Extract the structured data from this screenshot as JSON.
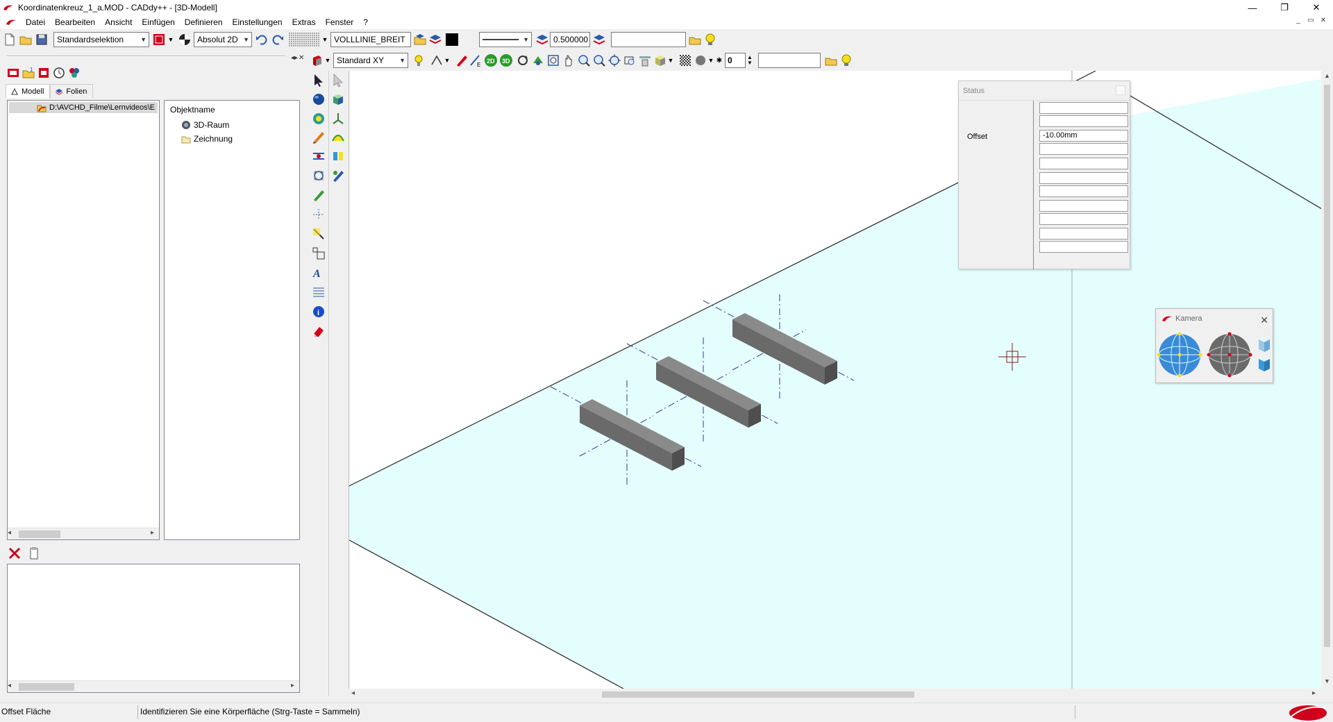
{
  "window": {
    "title": "Koordinatenkreuz_1_a.MOD  -  CADdy++ - [3D-Modell]",
    "controls": [
      "minimize-icon",
      "restore-icon",
      "close-icon"
    ]
  },
  "menu": [
    "Datei",
    "Bearbeiten",
    "Ansicht",
    "Einfügen",
    "Definieren",
    "Einstellungen",
    "Extras",
    "Fenster",
    "?"
  ],
  "toolbar1": {
    "selection_mode": "Standardselektion",
    "coord_mode": "Absolut 2D",
    "line_type": "VOLLLINIE_BREIT",
    "line_width": "0.500000",
    "text_field": ""
  },
  "toolbar2": {
    "view_plane": "Standard XY",
    "layer_value": "0",
    "text_field": ""
  },
  "left_panel": {
    "tabs": [
      "Modell",
      "Folien"
    ],
    "tree_path": "D:\\AVCHD_Filme\\Lernvideos\\E",
    "objects_header": "Objektname",
    "objects": [
      "3D-Raum",
      "Zeichnung"
    ]
  },
  "status_panel": {
    "title": "Status",
    "label": "Offset",
    "fields": [
      "",
      "",
      "-10.00mm",
      "",
      "",
      "",
      "",
      "",
      "",
      "",
      ""
    ]
  },
  "kamera_panel": {
    "title": "Kamera"
  },
  "statusbar": {
    "function": "Offset Fläche",
    "prompt": "Identifizieren Sie eine Körperfläche (Strg-Taste = Sammeln)"
  },
  "colors": {
    "workplane": "#e4fdfd",
    "block_top": "#8a8a8a",
    "block_side": "#5e5e5e",
    "axis_line": "#3a3a8a",
    "brand_red": "#d0021b"
  }
}
